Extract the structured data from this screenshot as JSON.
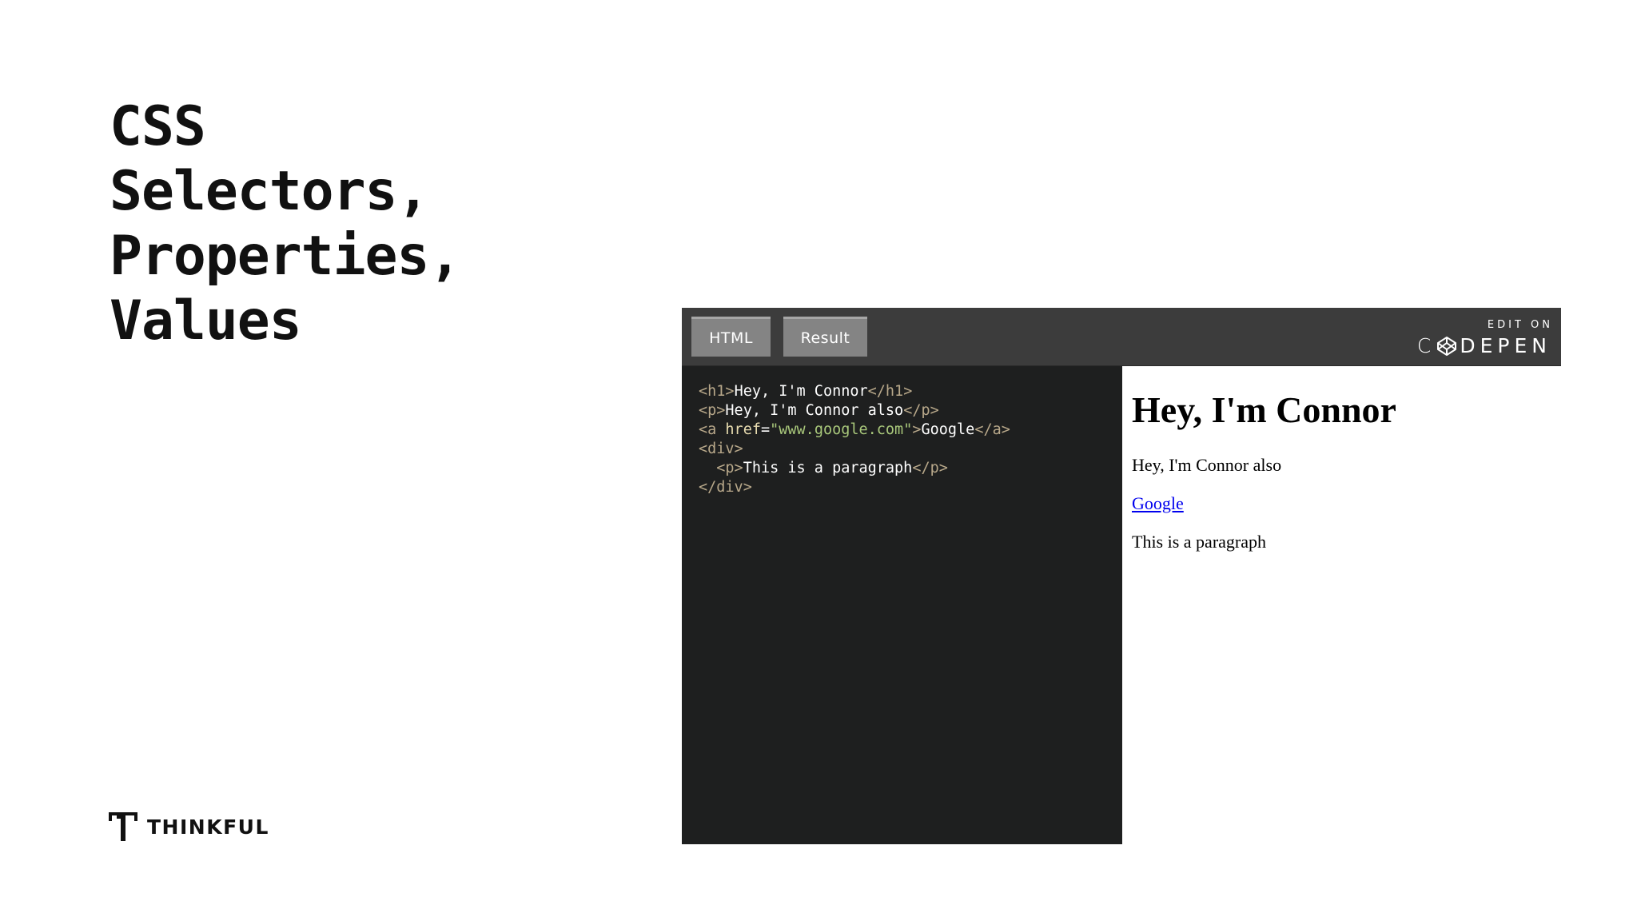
{
  "slide": {
    "title_lines": [
      "CSS",
      "Selectors,",
      "Properties,",
      "Values"
    ]
  },
  "logo": {
    "text": "THINKFUL"
  },
  "embed": {
    "tabs": {
      "html_label": "HTML",
      "result_label": "Result"
    },
    "brand": {
      "edit_on": "EDIT ON",
      "c": "C",
      "rest": "DEPEN"
    },
    "code": {
      "line1": {
        "open": "<h1>",
        "text": "Hey, I'm Connor",
        "close": "</h1>"
      },
      "line2": {
        "open": "<p>",
        "text": "Hey, I'm Connor also",
        "close": "</p>"
      },
      "line3": {
        "open": "<a ",
        "attr": "href",
        "eq": "=",
        "str": "\"www.google.com\"",
        "gt": ">",
        "text": "Google",
        "close": "</a>"
      },
      "line4": {
        "open": "<div>"
      },
      "line5": {
        "indent": "  ",
        "open": "<p>",
        "text": "This is a paragraph",
        "close": "</p>"
      },
      "line6": {
        "close": "</div>"
      }
    },
    "result": {
      "heading": "Hey, I'm Connor",
      "paragraph1": "Hey, I'm Connor also",
      "link": "Google",
      "paragraph2": "This is a paragraph"
    }
  }
}
